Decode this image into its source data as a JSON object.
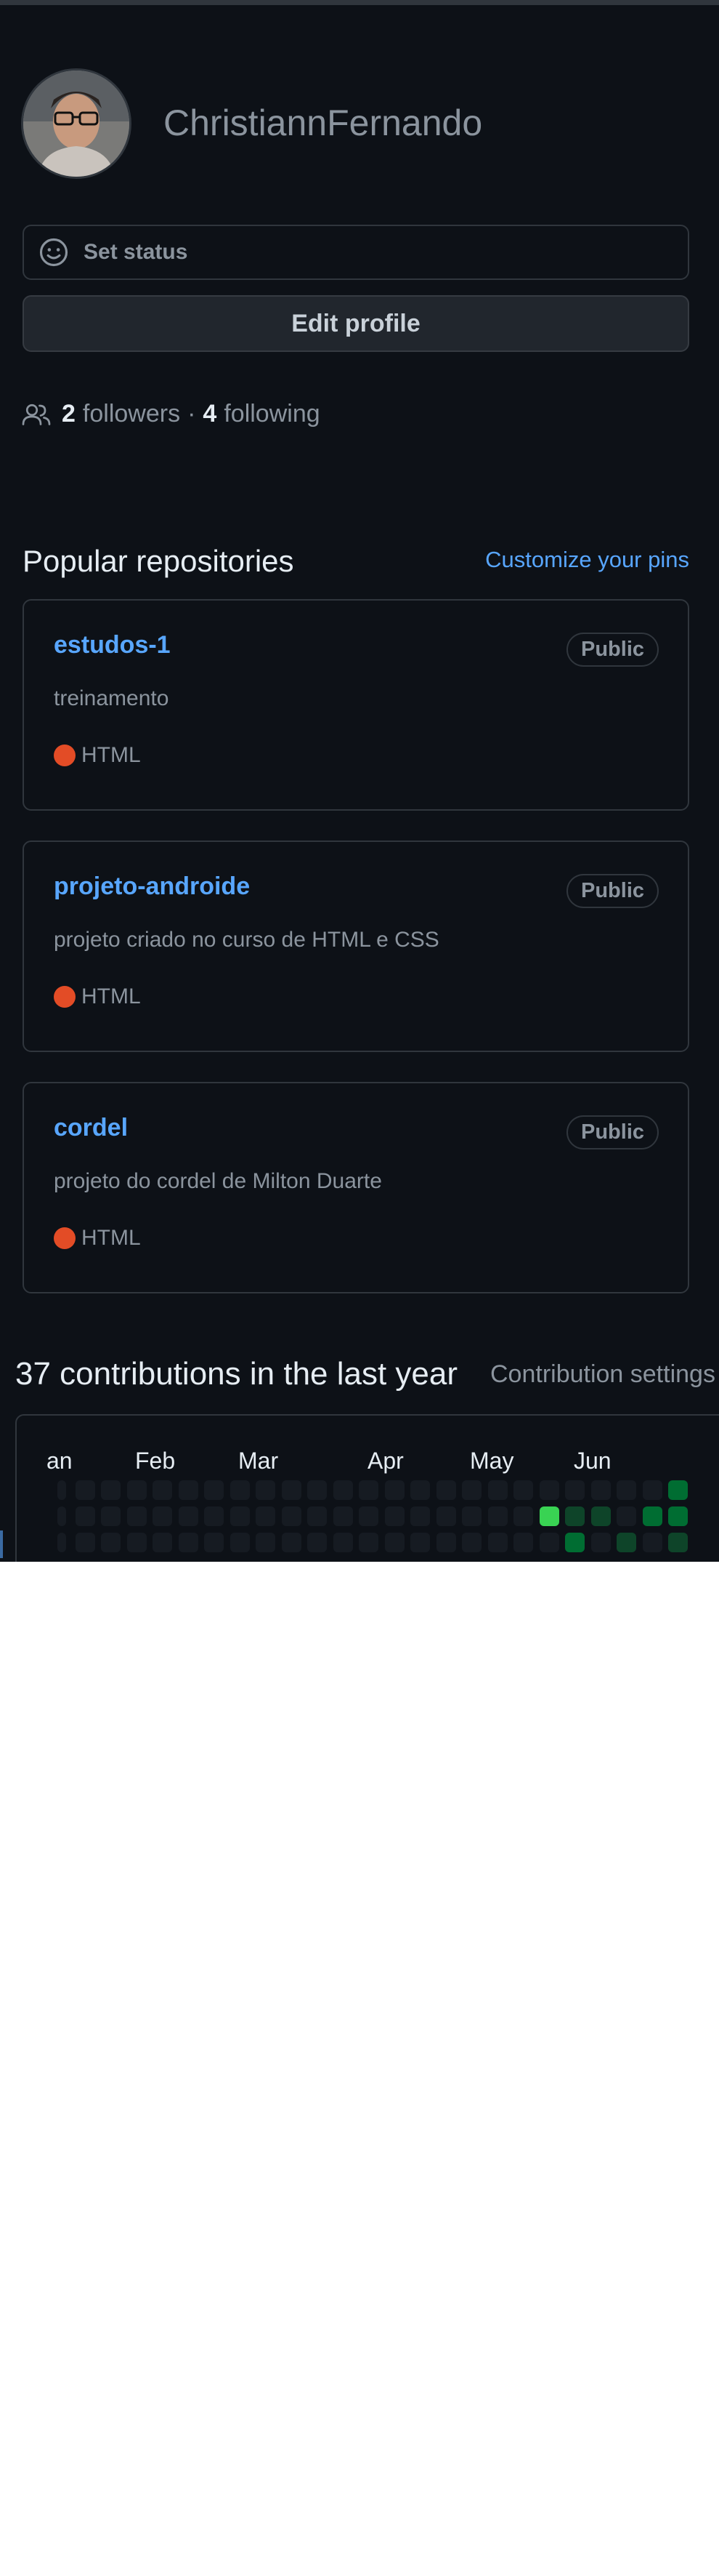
{
  "profile": {
    "username": "ChristiannFernando",
    "avatar_icon": "user-avatar-photo"
  },
  "status": {
    "label": "Set status",
    "icon": "smiley-icon"
  },
  "edit_profile": {
    "label": "Edit profile"
  },
  "follow": {
    "icon": "people-icon",
    "followers_count": "2",
    "followers_label": "followers",
    "separator": "·",
    "following_count": "4",
    "following_label": "following"
  },
  "popular": {
    "title": "Popular repositories",
    "customize_label": "Customize your pins",
    "repos": [
      {
        "name": "estudos-1",
        "visibility": "Public",
        "description": "treinamento",
        "language": "HTML",
        "lang_color": "#e34c26"
      },
      {
        "name": "projeto-androide",
        "visibility": "Public",
        "description": "projeto criado no curso de HTML e CSS",
        "language": "HTML",
        "lang_color": "#e34c26"
      },
      {
        "name": "cordel",
        "visibility": "Public",
        "description": "projeto do cordel de Milton Duarte",
        "language": "HTML",
        "lang_color": "#e34c26"
      }
    ]
  },
  "contributions": {
    "title": "37 contributions in the last year",
    "settings_label": "Contribution settings",
    "months": [
      "an",
      "Feb",
      "Mar",
      "Apr",
      "May",
      "Jun"
    ],
    "colors": {
      "empty": "#161b22",
      "level1": "#0e4429",
      "level2": "#006d32",
      "level3": "#26a641",
      "level4": "#39d353"
    },
    "last_weeks": [
      {
        "week": 19,
        "levels": [
          0,
          4,
          0
        ]
      },
      {
        "week": 20,
        "levels": [
          0,
          1,
          2
        ]
      },
      {
        "week": 21,
        "levels": [
          0,
          1,
          0
        ]
      },
      {
        "week": 22,
        "levels": [
          0,
          0,
          1
        ]
      },
      {
        "week": 23,
        "levels": [
          0,
          2,
          0
        ]
      },
      {
        "week": 24,
        "levels": [
          2,
          2,
          1
        ]
      }
    ]
  }
}
